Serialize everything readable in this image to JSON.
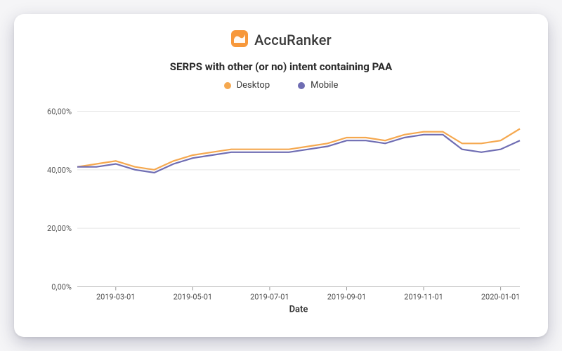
{
  "brand": {
    "name": "AccuRanker"
  },
  "colors": {
    "desktop": "#f5a84f",
    "mobile": "#6f6db3"
  },
  "chart_data": {
    "type": "line",
    "title": "SERPS with other (or no) intent containing PAA",
    "xlabel": "Date",
    "ylabel": "",
    "y_ticks": [
      "0,00%",
      "20,00%",
      "40,00%",
      "60,00%"
    ],
    "ylim": [
      0,
      60
    ],
    "x_tick_labels": [
      "2019-03-01",
      "2019-05-01",
      "2019-07-01",
      "2019-09-01",
      "2019-11-01",
      "2020-01-01"
    ],
    "x": [
      "2019-02-01",
      "2019-02-15",
      "2019-03-01",
      "2019-03-15",
      "2019-04-01",
      "2019-04-15",
      "2019-05-01",
      "2019-05-15",
      "2019-06-01",
      "2019-06-15",
      "2019-07-01",
      "2019-07-15",
      "2019-08-01",
      "2019-08-15",
      "2019-09-01",
      "2019-09-15",
      "2019-10-01",
      "2019-10-15",
      "2019-11-01",
      "2019-11-15",
      "2019-12-01",
      "2019-12-15",
      "2020-01-01",
      "2020-01-15"
    ],
    "series": [
      {
        "name": "Desktop",
        "color": "#f5a84f",
        "values": [
          41,
          42,
          43,
          41,
          40,
          43,
          45,
          46,
          47,
          47,
          47,
          47,
          48,
          49,
          51,
          51,
          50,
          52,
          53,
          53,
          49,
          49,
          50,
          54
        ]
      },
      {
        "name": "Mobile",
        "color": "#6f6db3",
        "values": [
          41,
          41,
          42,
          40,
          39,
          42,
          44,
          45,
          46,
          46,
          46,
          46,
          47,
          48,
          50,
          50,
          49,
          51,
          52,
          52,
          47,
          46,
          47,
          50
        ]
      }
    ]
  }
}
